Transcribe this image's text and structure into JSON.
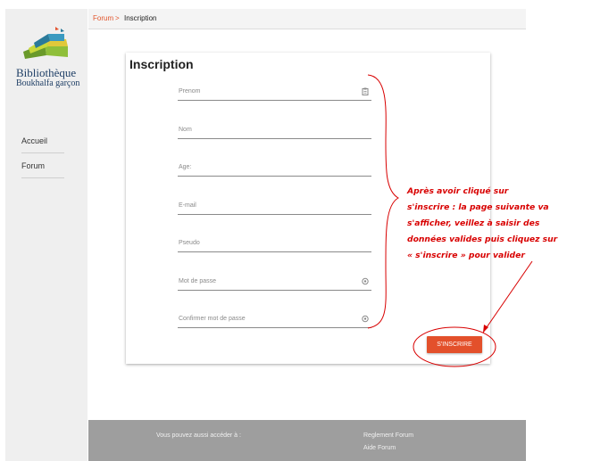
{
  "brand": {
    "name": "Bibliothèque",
    "subtitle": "Boukhalfa garçon"
  },
  "sidebar": {
    "items": [
      {
        "label": "Accueil"
      },
      {
        "label": "Forum"
      }
    ]
  },
  "breadcrumb": {
    "parent": "Forum",
    "separator": ">",
    "current": "Inscription"
  },
  "form": {
    "title": "Inscription",
    "fields": [
      {
        "label": "Prenom",
        "icon": "clipboard-icon"
      },
      {
        "label": "Nom"
      },
      {
        "label": "Age:"
      },
      {
        "label": "E-mail"
      },
      {
        "label": "Pseudo"
      },
      {
        "label": "Mot de passe",
        "icon": "lock-icon"
      },
      {
        "label": "Confirmer mot de passe",
        "icon": "lock-icon"
      }
    ],
    "submit_label": "S'INSCRIRE"
  },
  "footer": {
    "text": "Vous pouvez aussi accéder à :",
    "links": [
      {
        "label": "Reglement Forum"
      },
      {
        "label": "Aide Forum"
      }
    ]
  },
  "annotation": {
    "lines": [
      "Après avoir cliqué sur",
      "s'inscrire : la  page suivante va",
      "s'afficher, veillez à saisir des",
      "données valides puis cliquez sur",
      "« s'inscrire » pour valider"
    ],
    "color": "#d80000"
  },
  "colors": {
    "accent": "#e3502b",
    "sidebar_bg": "#efefef",
    "footer_bg": "#9e9e9e"
  }
}
